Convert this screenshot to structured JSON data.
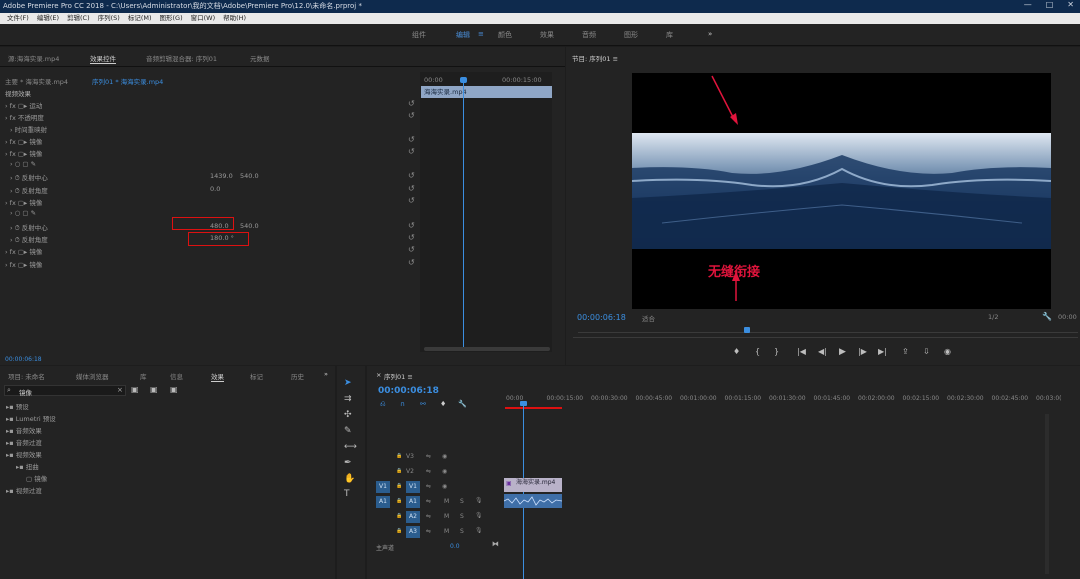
{
  "title": "Adobe Premiere Pro CC 2018 - C:\\Users\\Administrator\\我的文档\\Adobe\\Premiere Pro\\12.0\\未命名.prproj *",
  "window_controls": [
    "—",
    "□",
    "✕"
  ],
  "menu": [
    "文件(F)",
    "编辑(E)",
    "剪辑(C)",
    "序列(S)",
    "标记(M)",
    "图形(G)",
    "窗口(W)",
    "帮助(H)"
  ],
  "workspaces": [
    "组件",
    "编辑",
    "颜色",
    "效果",
    "音频",
    "图形",
    "库"
  ],
  "workspace_menu": "≡",
  "workspace_more": "»",
  "top_left_tabs": [
    "源:海海实录.mp4",
    "效果控件",
    "音频剪辑混合器: 序列01",
    "元数据"
  ],
  "effect_controls": {
    "source_label": "主要 * 海海实录.mp4",
    "sequence_label": "序列01 * 海海实录.mp4",
    "section": "视频效果",
    "rows": [
      {
        "label": "fx  ▢▸ 运动",
        "indent": 1
      },
      {
        "label": "fx  不透明度",
        "indent": 1
      },
      {
        "label": "时间重映射",
        "indent": 2
      },
      {
        "label": "fx  ▢▸ 镜像",
        "indent": 1
      },
      {
        "label": "fx  ▢▸ 镜像",
        "indent": 1
      },
      {
        "label": "○ ▢ ✎",
        "indent": 2
      },
      {
        "label": "⏱ 反射中心",
        "indent": 2,
        "v1": "1439.0",
        "v2": "540.0"
      },
      {
        "label": "⏱ 反射角度",
        "indent": 2,
        "v1": "0.0"
      },
      {
        "label": "fx  ▢▸ 镜像",
        "indent": 1
      },
      {
        "label": "○ ▢ ✎",
        "indent": 2
      },
      {
        "label": "⏱ 反射中心",
        "indent": 2,
        "v1": "480.0",
        "v2": "540.0"
      },
      {
        "label": "⏱ 反射角度",
        "indent": 2,
        "v1": "180.0 °"
      },
      {
        "label": "fx  ▢▸ 镜像",
        "indent": 1
      },
      {
        "label": "fx  ▢▸ 镜像",
        "indent": 1
      }
    ],
    "timecode": "00:00:06:18",
    "mini_timeline_start": "00:00",
    "mini_timeline_end": "00:00:15:00",
    "clip_name": "海海实录.mp4"
  },
  "program_monitor": {
    "tab": "节目: 序列01 ≡",
    "annotation": "无缝衔接",
    "timecode": "00:00:06:18",
    "fit": "适合",
    "quality": "1/2",
    "end_timecode": "00:00"
  },
  "project_panel": {
    "tabs": [
      "项目: 未命名",
      "媒体浏览器",
      "库",
      "信息",
      "效果",
      "标记",
      "历史"
    ],
    "more": "»",
    "search_value": "镜像",
    "folders": [
      "预设",
      "Lumetri 预设",
      "音频效果",
      "音频过渡",
      "视频效果",
      "扭曲",
      "镜像",
      "视频过渡"
    ]
  },
  "timeline": {
    "tab": "序列01 ≡",
    "timecode": "00:00:06:18",
    "timestamps": [
      "00:00",
      "00:00:15:00",
      "00:00:30:00",
      "00:00:45:00",
      "00:01:00:00",
      "00:01:15:00",
      "00:01:30:00",
      "00:01:45:00",
      "00:02:00:00",
      "00:02:15:00",
      "00:02:30:00",
      "00:02:45:00",
      "00:03:0("
    ],
    "video_tracks": [
      "V3",
      "V2",
      "V1"
    ],
    "audio_tracks": [
      "A1",
      "A2",
      "A3"
    ],
    "master": "主声道",
    "master_value": "0.0",
    "clip_name": "海海实录.mp4",
    "mute": "M",
    "solo": "S",
    "sync_label": "V1"
  },
  "colors": {
    "accent": "#3b8ee0",
    "annotation": "#e0143c",
    "highlight_box": "#d11111",
    "title_bg": "#0e2a4d"
  }
}
